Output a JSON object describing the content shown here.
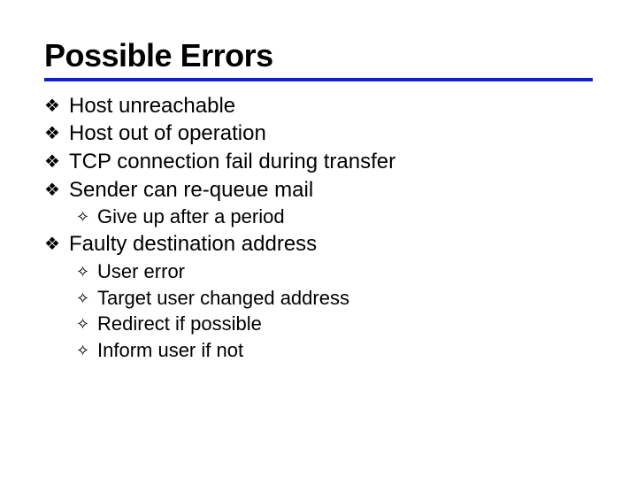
{
  "slide": {
    "title": "Possible Errors",
    "items": [
      {
        "text": "Host unreachable"
      },
      {
        "text": "Host out of operation"
      },
      {
        "text": "TCP connection fail during transfer"
      },
      {
        "text": "Sender can re-queue mail"
      },
      {
        "text": "Give up after a period",
        "level": 2
      },
      {
        "text": "Faulty destination address"
      },
      {
        "text": "User error",
        "level": 2
      },
      {
        "text": "Target user changed address",
        "level": 2
      },
      {
        "text": "Redirect if possible",
        "level": 2
      },
      {
        "text": "Inform user if not",
        "level": 2
      }
    ],
    "bullets": {
      "lvl1": "❚",
      "lvl2": "❙"
    },
    "bulletGlyphs": {
      "lvl1": "▞",
      "lvl2": "▗"
    }
  },
  "glyphs": {
    "lvl1": "❖",
    "lvl2": "◇"
  }
}
